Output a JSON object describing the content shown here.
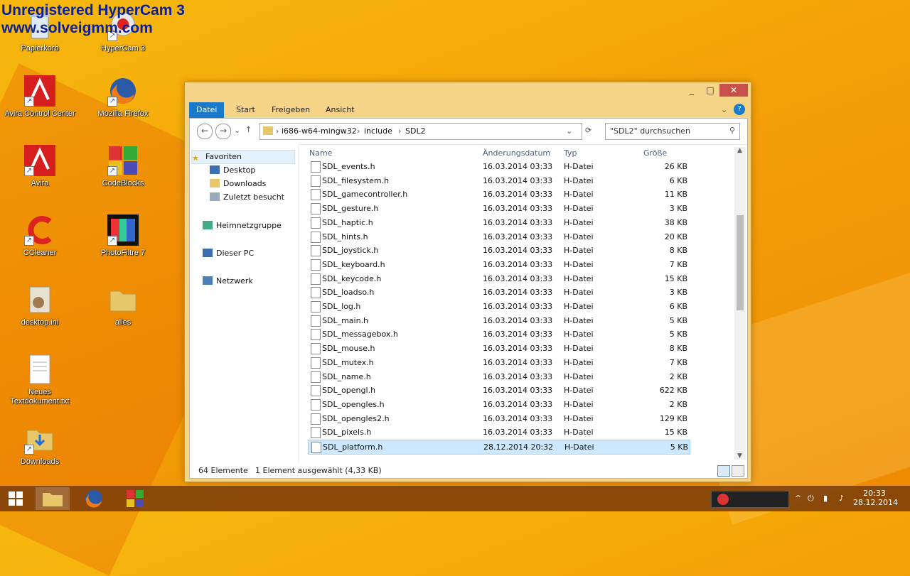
{
  "watermark": {
    "line1": "Unregistered HyperCam 3",
    "line2": "www.solveigmm.com"
  },
  "desktop_icons": [
    {
      "label": "Papierkorb"
    },
    {
      "label": "HyperCam 3"
    },
    {
      "label": "Avira Control Center"
    },
    {
      "label": "Mozilla Firefox"
    },
    {
      "label": "Avira"
    },
    {
      "label": "CodeBlocks"
    },
    {
      "label": "CCleaner"
    },
    {
      "label": "PhotoFiltre 7"
    },
    {
      "label": "desktop.ini"
    },
    {
      "label": "alles"
    },
    {
      "label": "Neues Textdokument.txt"
    },
    {
      "label": "Downloads"
    }
  ],
  "window": {
    "ribbon_tabs": [
      "Datei",
      "Start",
      "Freigeben",
      "Ansicht"
    ],
    "address": {
      "segments": [
        "i686-w64-mingw32",
        "include",
        "SDL2"
      ]
    },
    "search": {
      "placeholder": "\"SDL2\" durchsuchen"
    },
    "nav": {
      "favorites": "Favoriten",
      "items": [
        "Desktop",
        "Downloads",
        "Zuletzt besucht"
      ],
      "homegroup": "Heimnetzgruppe",
      "thispc": "Dieser PC",
      "network": "Netzwerk"
    },
    "columns": {
      "name": "Name",
      "date": "Änderungsdatum",
      "type": "Typ",
      "size": "Größe"
    },
    "files": [
      {
        "name": "SDL_events.h",
        "date": "16.03.2014 03:33",
        "type": "H-Datei",
        "size": "26 KB"
      },
      {
        "name": "SDL_filesystem.h",
        "date": "16.03.2014 03:33",
        "type": "H-Datei",
        "size": "6 KB"
      },
      {
        "name": "SDL_gamecontroller.h",
        "date": "16.03.2014 03:33",
        "type": "H-Datei",
        "size": "11 KB"
      },
      {
        "name": "SDL_gesture.h",
        "date": "16.03.2014 03:33",
        "type": "H-Datei",
        "size": "3 KB"
      },
      {
        "name": "SDL_haptic.h",
        "date": "16.03.2014 03:33",
        "type": "H-Datei",
        "size": "38 KB"
      },
      {
        "name": "SDL_hints.h",
        "date": "16.03.2014 03:33",
        "type": "H-Datei",
        "size": "20 KB"
      },
      {
        "name": "SDL_joystick.h",
        "date": "16.03.2014 03:33",
        "type": "H-Datei",
        "size": "8 KB"
      },
      {
        "name": "SDL_keyboard.h",
        "date": "16.03.2014 03:33",
        "type": "H-Datei",
        "size": "7 KB"
      },
      {
        "name": "SDL_keycode.h",
        "date": "16.03.2014 03:33",
        "type": "H-Datei",
        "size": "15 KB"
      },
      {
        "name": "SDL_loadso.h",
        "date": "16.03.2014 03:33",
        "type": "H-Datei",
        "size": "3 KB"
      },
      {
        "name": "SDL_log.h",
        "date": "16.03.2014 03:33",
        "type": "H-Datei",
        "size": "6 KB"
      },
      {
        "name": "SDL_main.h",
        "date": "16.03.2014 03:33",
        "type": "H-Datei",
        "size": "5 KB"
      },
      {
        "name": "SDL_messagebox.h",
        "date": "16.03.2014 03:33",
        "type": "H-Datei",
        "size": "5 KB"
      },
      {
        "name": "SDL_mouse.h",
        "date": "16.03.2014 03:33",
        "type": "H-Datei",
        "size": "8 KB"
      },
      {
        "name": "SDL_mutex.h",
        "date": "16.03.2014 03:33",
        "type": "H-Datei",
        "size": "7 KB"
      },
      {
        "name": "SDL_name.h",
        "date": "16.03.2014 03:33",
        "type": "H-Datei",
        "size": "2 KB"
      },
      {
        "name": "SDL_opengl.h",
        "date": "16.03.2014 03:33",
        "type": "H-Datei",
        "size": "622 KB"
      },
      {
        "name": "SDL_opengles.h",
        "date": "16.03.2014 03:33",
        "type": "H-Datei",
        "size": "2 KB"
      },
      {
        "name": "SDL_opengles2.h",
        "date": "16.03.2014 03:33",
        "type": "H-Datei",
        "size": "129 KB"
      },
      {
        "name": "SDL_pixels.h",
        "date": "16.03.2014 03:33",
        "type": "H-Datei",
        "size": "15 KB"
      },
      {
        "name": "SDL_platform.h",
        "date": "28.12.2014 20:32",
        "type": "H-Datei",
        "size": "5 KB",
        "selected": true
      }
    ],
    "status": {
      "count": "64 Elemente",
      "selection": "1 Element ausgewählt (4,33 KB)"
    }
  },
  "taskbar": {
    "time": "20:33",
    "date": "28.12.2014"
  }
}
